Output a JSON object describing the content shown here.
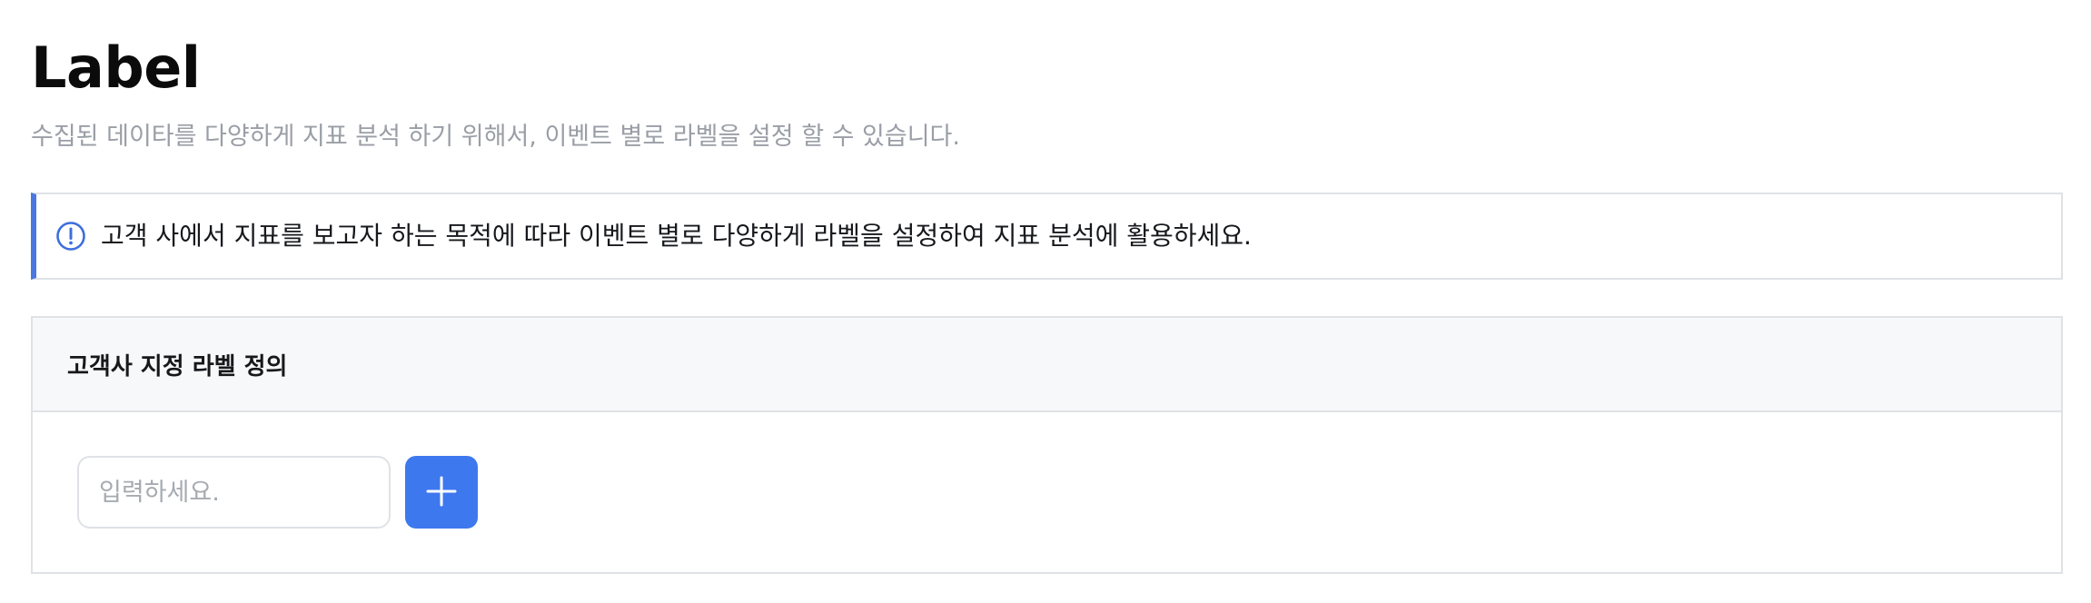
{
  "header": {
    "title": "Label",
    "subtitle": "수집된 데이타를 다양하게 지표 분석 하기 위해서, 이벤트 별로 라벨을 설정 할 수 있습니다."
  },
  "notice": {
    "icon": "info-circle-icon",
    "text": "고객 사에서 지표를 보고자 하는 목적에 따라 이벤트 별로 다양하게 라벨을 설정하여 지표 분석에 활용하세요.",
    "accent_color": "#4a78e0"
  },
  "label_definition": {
    "title": "고객사 지정 라벨 정의",
    "input": {
      "value": "",
      "placeholder": "입력하세요."
    },
    "add_button": {
      "icon": "plus-icon",
      "color": "#3d78ef"
    }
  }
}
